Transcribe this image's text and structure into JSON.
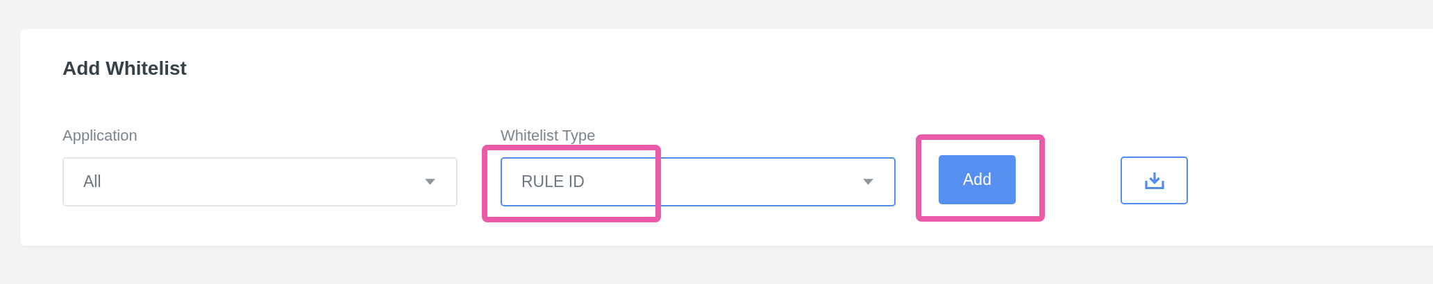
{
  "card": {
    "title": "Add Whitelist",
    "fields": [
      {
        "label": "Application",
        "value": "All",
        "focused": false,
        "highlighted": false
      },
      {
        "label": "Whitelist Type",
        "value": "RULE ID",
        "focused": true,
        "highlighted": true
      }
    ],
    "add_button": {
      "label": "Add",
      "highlighted": true
    }
  }
}
